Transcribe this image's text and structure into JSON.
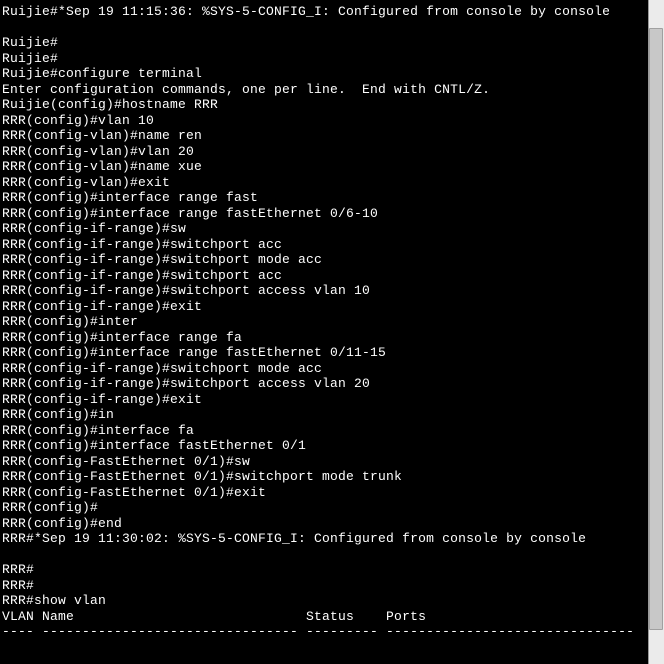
{
  "lines": [
    "Ruijie#*Sep 19 11:15:36: %SYS-5-CONFIG_I: Configured from console by console",
    "",
    "Ruijie#",
    "Ruijie#",
    "Ruijie#configure terminal",
    "Enter configuration commands, one per line.  End with CNTL/Z.",
    "Ruijie(config)#hostname RRR",
    "RRR(config)#vlan 10",
    "RRR(config-vlan)#name ren",
    "RRR(config-vlan)#vlan 20",
    "RRR(config-vlan)#name xue",
    "RRR(config-vlan)#exit",
    "RRR(config)#interface range fast",
    "RRR(config)#interface range fastEthernet 0/6-10",
    "RRR(config-if-range)#sw",
    "RRR(config-if-range)#switchport acc",
    "RRR(config-if-range)#switchport mode acc",
    "RRR(config-if-range)#switchport acc",
    "RRR(config-if-range)#switchport access vlan 10",
    "RRR(config-if-range)#exit",
    "RRR(config)#inter",
    "RRR(config)#interface range fa",
    "RRR(config)#interface range fastEthernet 0/11-15",
    "RRR(config-if-range)#switchport mode acc",
    "RRR(config-if-range)#switchport access vlan 20",
    "RRR(config-if-range)#exit",
    "RRR(config)#in",
    "RRR(config)#interface fa",
    "RRR(config)#interface fastEthernet 0/1",
    "RRR(config-FastEthernet 0/1)#sw",
    "RRR(config-FastEthernet 0/1)#switchport mode trunk",
    "RRR(config-FastEthernet 0/1)#exit",
    "RRR(config)#",
    "RRR(config)#end",
    "RRR#*Sep 19 11:30:02: %SYS-5-CONFIG_I: Configured from console by console",
    "",
    "RRR#",
    "RRR#",
    "RRR#show vlan",
    "VLAN Name                             Status    Ports",
    "---- -------------------------------- --------- -------------------------------"
  ]
}
